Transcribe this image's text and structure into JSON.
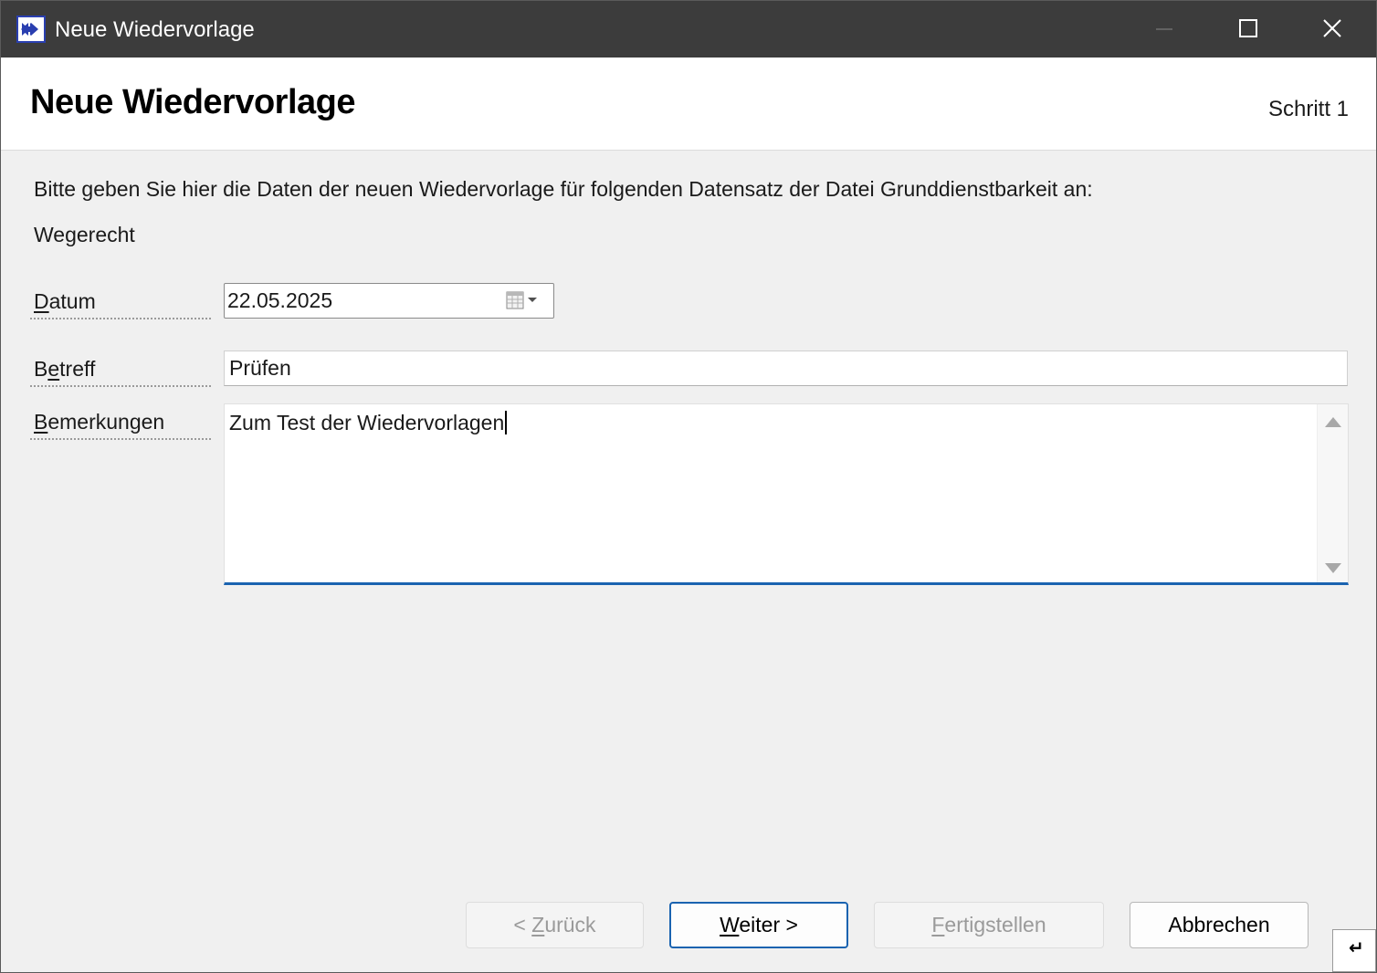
{
  "window": {
    "title": "Neue Wiedervorlage"
  },
  "header": {
    "title": "Neue Wiedervorlage",
    "step": "Schritt 1"
  },
  "intro": {
    "text": "Bitte geben Sie hier die Daten der neuen Wiedervorlage für folgenden Datensatz der Datei Grunddienstbarkeit an:",
    "record": "Wegerecht"
  },
  "fields": {
    "datum": {
      "label_mnemonic": "D",
      "label_rest": "atum",
      "value": "22.05.2025"
    },
    "betreff": {
      "label_pre": "B",
      "label_mnemonic": "e",
      "label_rest": "treff",
      "value": "Prüfen"
    },
    "bemerkungen": {
      "label_mnemonic": "B",
      "label_rest": "emerkungen",
      "value": "Zum Test der Wiedervorlagen"
    }
  },
  "buttons": {
    "back_pre": "< ",
    "back_mnemonic": "Z",
    "back_rest": "urück",
    "next_mnemonic": "W",
    "next_rest": "eiter >",
    "finish_mnemonic": "F",
    "finish_rest": "ertigstellen",
    "cancel": "Abbrechen"
  },
  "icons": {
    "app": "arrow-forward-icon",
    "calendar": "calendar-icon",
    "dropdown": "chevron-down-icon",
    "grip": "size-grip-icon"
  },
  "colors": {
    "titlebar": "#3c3c3c",
    "accent": "#1a63b0",
    "icon_blue": "#2a3fb0"
  }
}
